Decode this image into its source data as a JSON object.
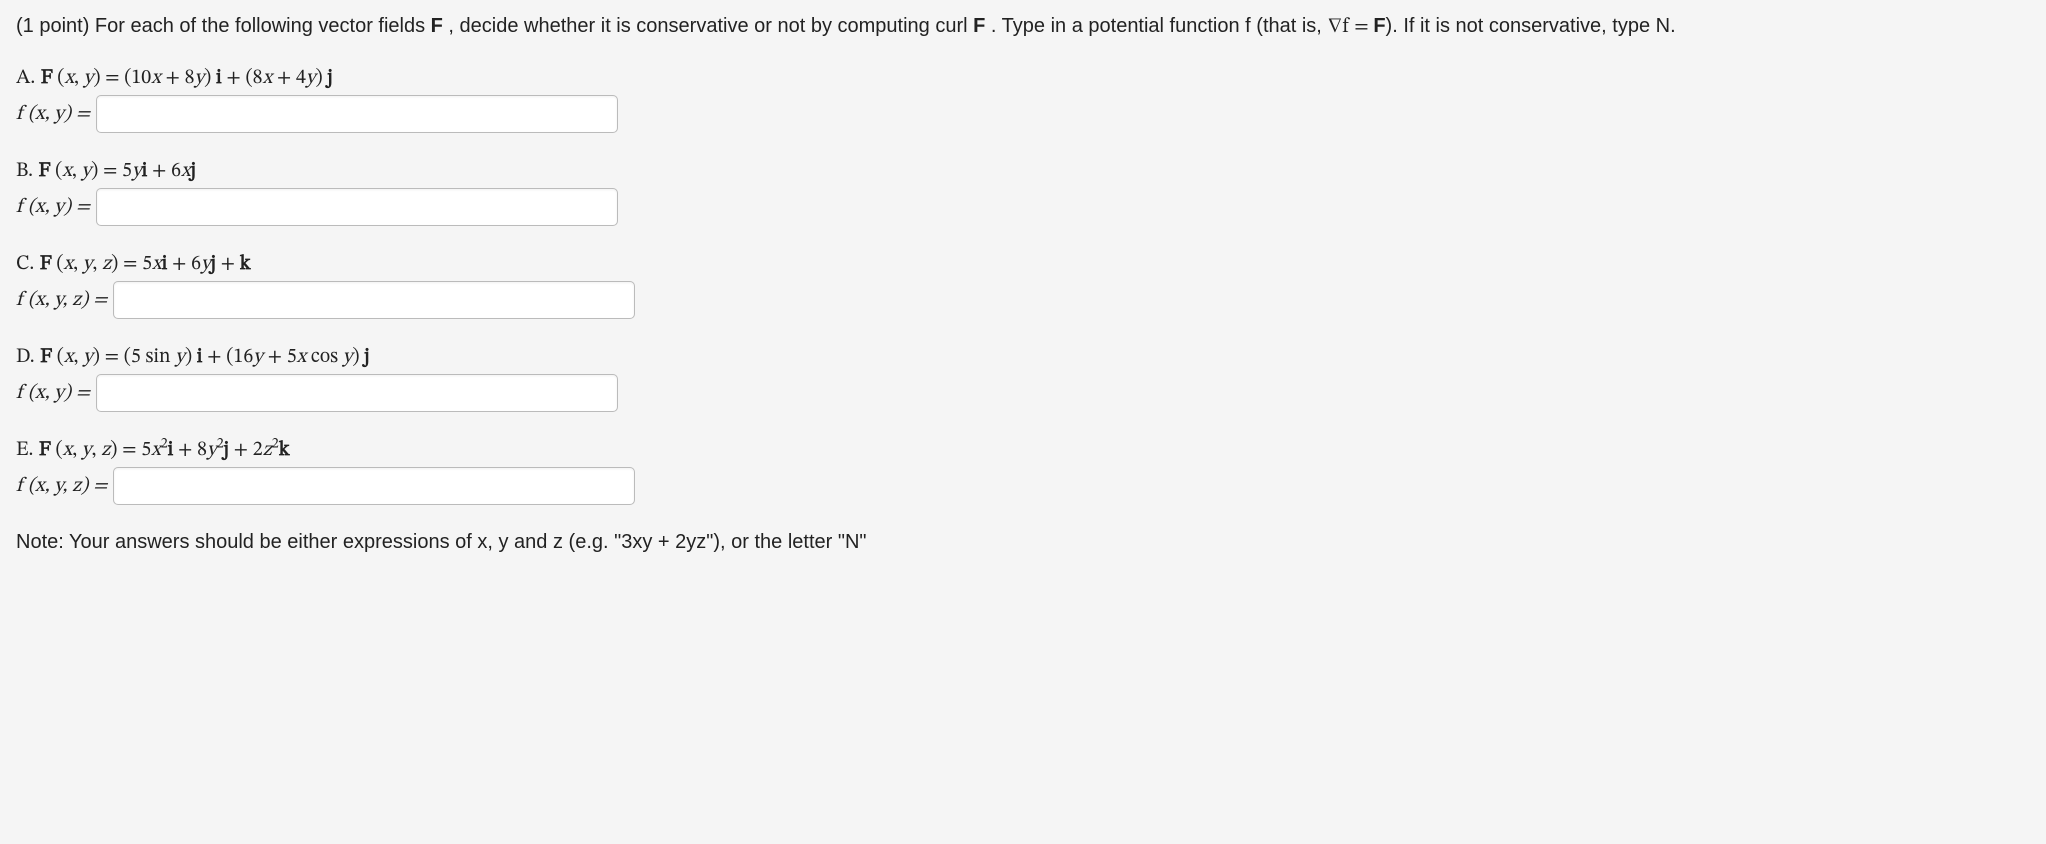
{
  "intro": {
    "points": "(1 point)",
    "text1": " For each of the following vector fields ",
    "F": "F",
    "text2": " , decide whether it is conservative or not by computing curl ",
    "F2": "F",
    "text3": " . Type in a potential function f (that is, ",
    "gradf": "∇f = ",
    "F3": "F",
    "text4": "). If it is not conservative, type N."
  },
  "parts": {
    "A": {
      "label": "A.",
      "lhs_html": "<span class='bold'>F</span> (<span class='math'>x</span>, <span class='math'>y</span>) = (10<span class='math'>x</span> + 8<span class='math'>y</span>)<span class='bold'> i</span> + (8<span class='math'>x</span> + 4<span class='math'>y</span>)<span class='bold'> j</span>",
      "answer_label_html": "<span class='math'>f</span> (<span class='math'>x</span>, <span class='math'>y</span>) ="
    },
    "B": {
      "label": "B.",
      "lhs_html": "<span class='bold'>F</span> (<span class='math'>x</span>, <span class='math'>y</span>) = 5<span class='math'>y</span><span class='bold'>i</span> + 6<span class='math'>x</span><span class='bold'>j</span>",
      "answer_label_html": "<span class='math'>f</span> (<span class='math'>x</span>, <span class='math'>y</span>) ="
    },
    "C": {
      "label": "C.",
      "lhs_html": "<span class='bold'>F</span> (<span class='math'>x</span>, <span class='math'>y</span>, <span class='math'>z</span>) = 5<span class='math'>x</span><span class='bold'>i</span> + 6<span class='math'>y</span><span class='bold'>j</span> + <span class='bold'>k</span>",
      "answer_label_html": "<span class='math'>f</span> (<span class='math'>x</span>, <span class='math'>y</span>, <span class='math'>z</span>) ="
    },
    "D": {
      "label": "D.",
      "lhs_html": "<span class='bold'>F</span> (<span class='math'>x</span>, <span class='math'>y</span>) = (5 <span class='mathup'>sin</span> <span class='math'>y</span>)<span class='bold'> i</span> + (16<span class='math'>y</span> + 5<span class='math'>x</span> <span class='mathup'>cos</span> <span class='math'>y</span>)<span class='bold'> j</span>",
      "answer_label_html": "<span class='math'>f</span> (<span class='math'>x</span>, <span class='math'>y</span>) ="
    },
    "E": {
      "label": "E.",
      "lhs_html": "<span class='bold'>F</span> (<span class='math'>x</span>, <span class='math'>y</span>, <span class='math'>z</span>) = 5<span class='math'>x</span><sup>2</sup><span class='bold'>i</span> + 8<span class='math'>y</span><sup>2</sup><span class='bold'>j</span> + 2<span class='math'>z</span><sup>2</sup><span class='bold'>k</span>",
      "answer_label_html": "<span class='math'>f</span> (<span class='math'>x</span>, <span class='math'>y</span>, <span class='math'>z</span>) ="
    }
  },
  "note": "Note: Your answers should be either expressions of x, y and z (e.g. \"3xy + 2yz\"), or the letter \"N\""
}
